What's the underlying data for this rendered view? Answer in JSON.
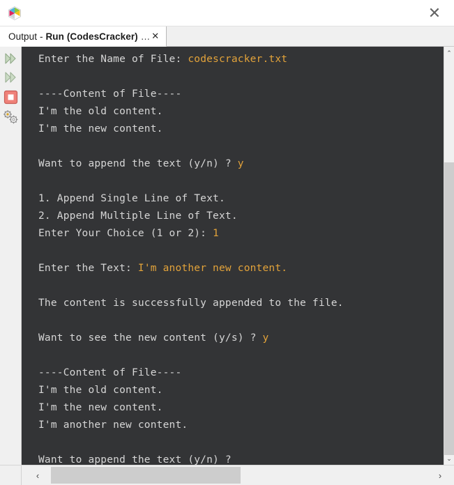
{
  "window": {
    "logo_icon": "netbeans-cube-icon",
    "close_label": "✕"
  },
  "tab": {
    "prefix": "Output - ",
    "bold_part": "Run (CodesCracker)",
    "ellipsis": "…",
    "close_label": "✕"
  },
  "sidebar": {
    "items": [
      {
        "icon": "rerun-double-chevron-icon",
        "label": "Re-run"
      },
      {
        "icon": "rerun-with-different-params-double-chevron-icon",
        "label": "Re-run with different parameters"
      },
      {
        "icon": "stop-square-icon",
        "label": "Stop process"
      },
      {
        "icon": "settings-gear-icon",
        "label": "Settings"
      }
    ]
  },
  "console": {
    "lines": [
      {
        "text": "Enter the Name of File: ",
        "input": "codescracker.txt"
      },
      {
        "text": ""
      },
      {
        "text": "----Content of File----"
      },
      {
        "text": "I'm the old content."
      },
      {
        "text": "I'm the new content."
      },
      {
        "text": ""
      },
      {
        "text": "Want to append the text (y/n) ? ",
        "input": "y"
      },
      {
        "text": ""
      },
      {
        "text": "1. Append Single Line of Text."
      },
      {
        "text": "2. Append Multiple Line of Text."
      },
      {
        "text": "Enter Your Choice (1 or 2): ",
        "input": "1"
      },
      {
        "text": ""
      },
      {
        "text": "Enter the Text: ",
        "input": "I'm another new content."
      },
      {
        "text": ""
      },
      {
        "text": "The content is successfully appended to the file."
      },
      {
        "text": ""
      },
      {
        "text": "Want to see the new content (y/s) ? ",
        "input": "y"
      },
      {
        "text": ""
      },
      {
        "text": "----Content of File----"
      },
      {
        "text": "I'm the old content."
      },
      {
        "text": "I'm the new content."
      },
      {
        "text": "I'm another new content."
      },
      {
        "text": ""
      },
      {
        "text": "Want to append the text (y/n) ? "
      }
    ]
  },
  "scrollbars": {
    "vertical": {
      "up_arrow": "⌃",
      "down_arrow": "⌄"
    },
    "horizontal": {
      "left_arrow": "‹",
      "right_arrow": "›"
    }
  },
  "colors": {
    "console_background": "#333436",
    "console_text": "#d6d6d6",
    "console_input": "#e3a33a",
    "chrome_background": "#f0f0f0",
    "scrollbar_thumb": "#cdcdcd"
  }
}
